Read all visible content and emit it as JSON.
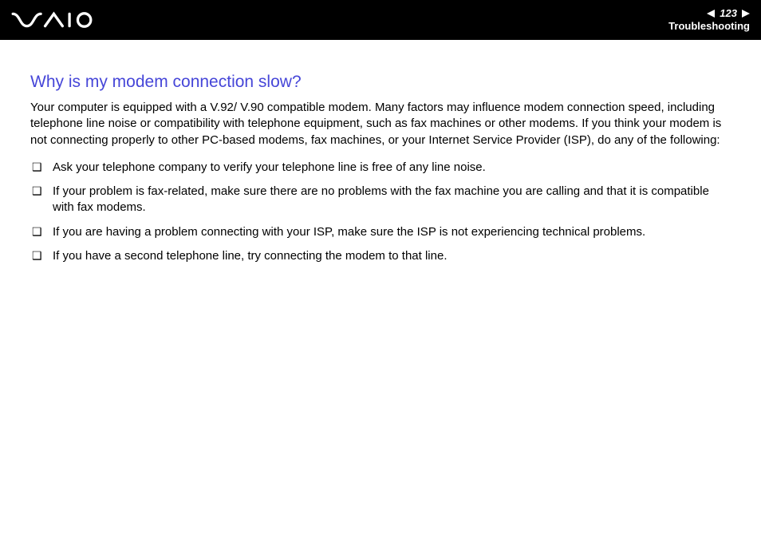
{
  "header": {
    "page_number": "123",
    "section": "Troubleshooting"
  },
  "content": {
    "title": "Why is my modem connection slow?",
    "intro": "Your computer is equipped with a V.92/ V.90 compatible modem. Many factors may influence modem connection speed, including telephone line noise or compatibility with telephone equipment, such as fax machines or other modems. If you think your modem is not connecting properly to other PC-based modems, fax machines, or your Internet Service Provider (ISP), do any of the following:",
    "bullets": [
      "Ask your telephone company to verify your telephone line is free of any line noise.",
      "If your problem is fax-related, make sure there are no problems with the fax machine you are calling and that it is compatible with fax modems.",
      "If you are having a problem connecting with your ISP, make sure the ISP is not experiencing technical problems.",
      "If you have a second telephone line, try connecting the modem to that line."
    ]
  }
}
